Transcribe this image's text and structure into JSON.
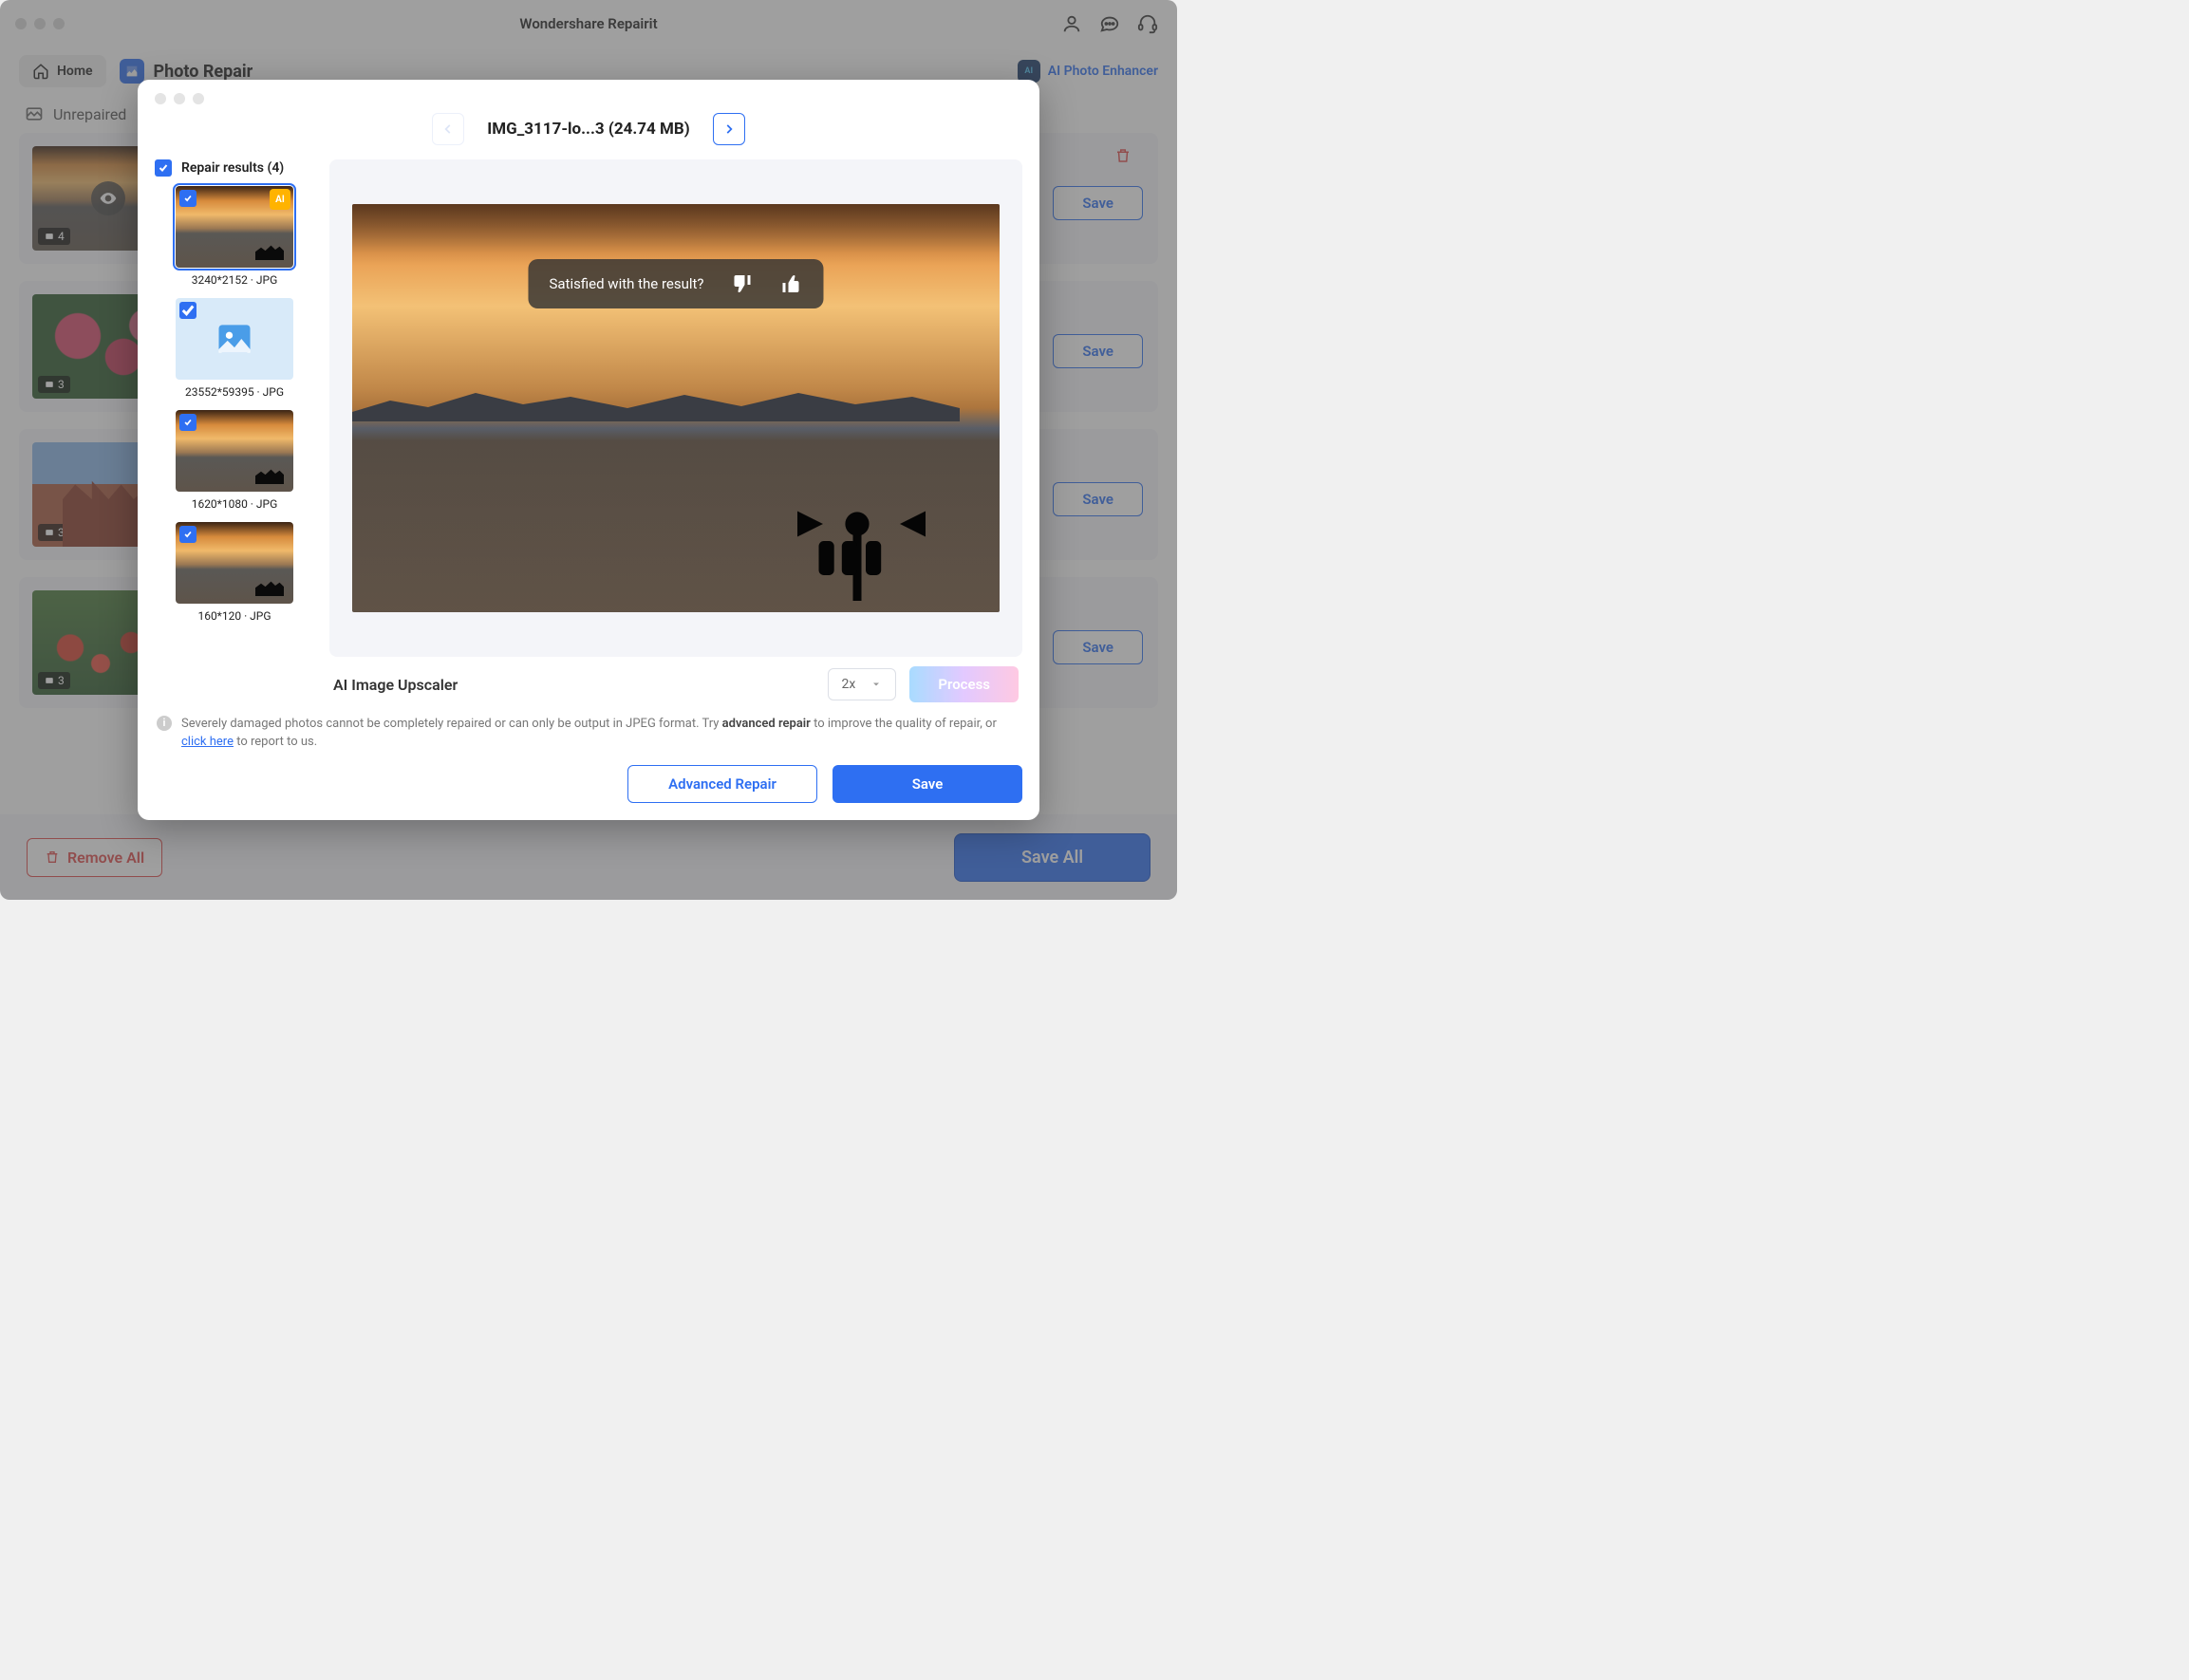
{
  "app_title": "Wondershare Repairit",
  "toolbar": {
    "home": "Home",
    "section": "Photo Repair",
    "ai_enhancer": "AI Photo Enhancer"
  },
  "section_header": "Unrepaired",
  "rows": [
    {
      "count": "4",
      "save": "Save"
    },
    {
      "count": "3",
      "save": "Save"
    },
    {
      "count": "3",
      "save": "Save"
    },
    {
      "count": "3",
      "save": "Save"
    }
  ],
  "footer": {
    "remove_all": "Remove All",
    "save_all": "Save All"
  },
  "modal": {
    "file_name": "IMG_3117-lo...3 (24.74 MB)",
    "results_header": "Repair results (4)",
    "results": [
      {
        "caption": "3240*2152 · JPG",
        "ai": true
      },
      {
        "caption": "23552*59395 · JPG",
        "placeholder": true
      },
      {
        "caption": "1620*1080 · JPG"
      },
      {
        "caption": "160*120 · JPG"
      }
    ],
    "feedback_question": "Satisfied with the result?",
    "upscaler_label": "AI Image Upscaler",
    "scale_value": "2x",
    "process": "Process",
    "info_prefix": "Severely damaged photos cannot be completely repaired or can only be output in JPEG format. Try ",
    "info_emph": "advanced repair",
    "info_mid": " to improve the quality of repair, or ",
    "info_link": "click here",
    "info_suffix": " to report to us.",
    "advanced_repair": "Advanced Repair",
    "save": "Save"
  }
}
